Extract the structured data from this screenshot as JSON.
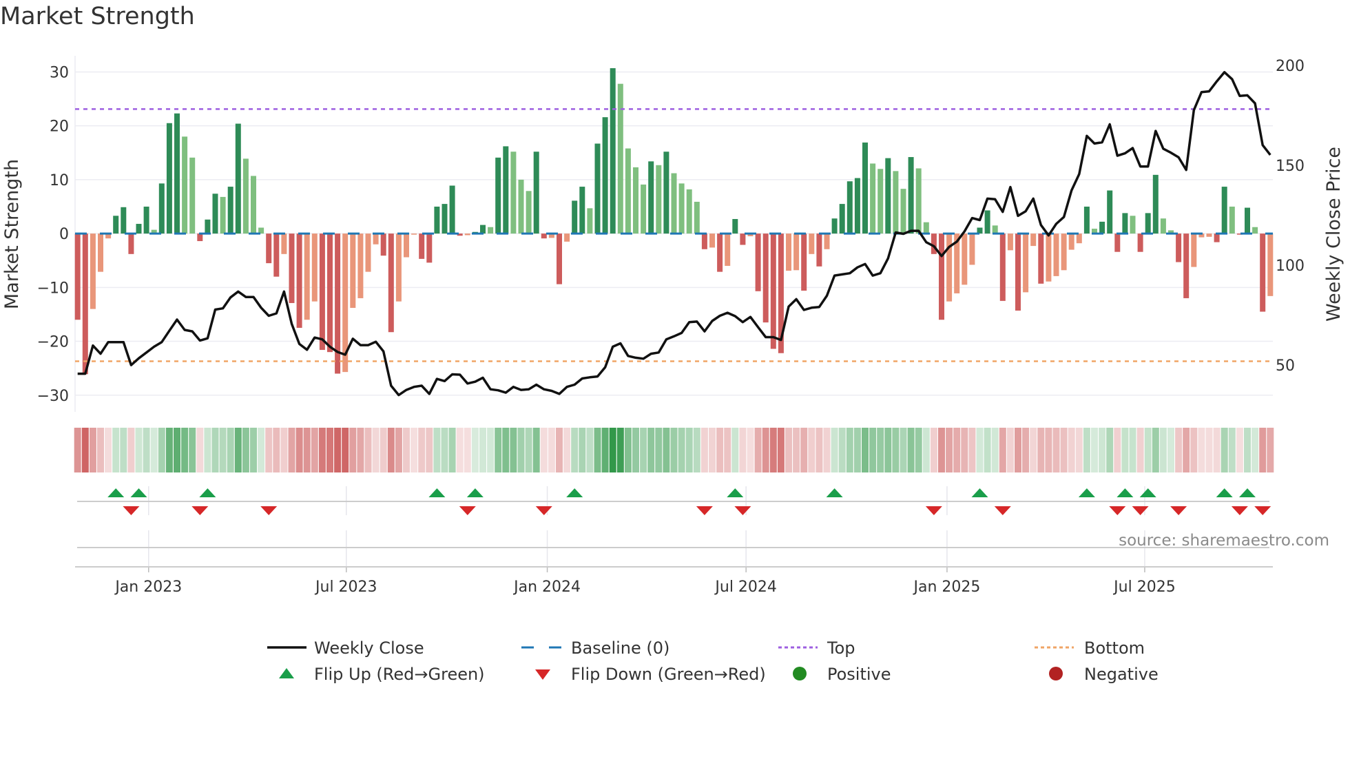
{
  "chart_data": {
    "type": "bar",
    "title": "Market Strength",
    "ylabel": "Market Strength",
    "y2label": "Weekly Close Price",
    "ylim": [
      -33.1,
      33
    ],
    "y2lim": [
      26.6,
      204.8
    ],
    "yticks": [
      30,
      20,
      10,
      0,
      -10,
      -20,
      -30
    ],
    "ytick_labels": [
      "30",
      "20",
      "10",
      "0",
      "−10",
      "−20",
      "−30"
    ],
    "y2ticks": [
      200,
      150,
      100,
      50
    ],
    "y2tick_labels": [
      "200",
      "150",
      "100",
      "50"
    ],
    "x_start_week": "2022-10-28",
    "x_frequency": "weekly",
    "xticks": [
      {
        "date": "2023-01-01",
        "label": "Jan 2023"
      },
      {
        "date": "2023-07-01",
        "label": "Jul 2023"
      },
      {
        "date": "2024-01-01",
        "label": "Jan 2024"
      },
      {
        "date": "2024-07-01",
        "label": "Jul 2024"
      },
      {
        "date": "2025-01-01",
        "label": "Jan 2025"
      },
      {
        "date": "2025-07-01",
        "label": "Jul 2025"
      }
    ],
    "top_threshold": 23.1,
    "bottom_threshold": -23.7,
    "baseline": 0,
    "strength": [
      -16,
      -26.1,
      -14,
      -7.1,
      -0.9,
      3.3,
      4.9,
      -3.8,
      1.8,
      5,
      0.7,
      9.3,
      20.5,
      22.3,
      18,
      14.1,
      -1.4,
      2.6,
      7.4,
      6.8,
      8.7,
      20.4,
      13.9,
      10.7,
      1.1,
      -5.5,
      -8,
      -3.8,
      -12.9,
      -17.5,
      -16,
      -12.6,
      -21.6,
      -22,
      -26,
      -25.7,
      -13.8,
      -12,
      -7.1,
      -2,
      -4.1,
      -18.3,
      -12.6,
      -4.4,
      -0.2,
      -4.7,
      -5.4,
      5,
      5.5,
      8.9,
      -0.4,
      -0.3,
      0.3,
      1.6,
      1.2,
      14.1,
      16.2,
      15.2,
      10,
      7.9,
      15.2,
      -0.9,
      -0.8,
      -9.4,
      -1.5,
      6.1,
      8.7,
      4.7,
      16.7,
      21.6,
      30.7,
      27.8,
      15.8,
      12.3,
      9.1,
      13.4,
      12.7,
      15.2,
      11.2,
      9.3,
      8.2,
      5.9,
      -2.9,
      -2.6,
      -7.1,
      -6,
      2.7,
      -2.1,
      -0.5,
      -10.7,
      -16.5,
      -21.4,
      -22.2,
      -6.9,
      -6.8,
      -10.6,
      -3.8,
      -6.1,
      -2.9,
      2.8,
      5.5,
      9.7,
      10.3,
      16.9,
      13,
      12,
      14,
      11.6,
      8.3,
      14.2,
      12.1,
      2.1,
      -3.8,
      -16,
      -12.6,
      -11.1,
      -9.5,
      -5.8,
      1.1,
      4.3,
      1.5,
      -12.5,
      -3.1,
      -14.3,
      -10.9,
      -2.3,
      -9.3,
      -8.9,
      -7.9,
      -6.8,
      -3,
      -1.8,
      5,
      0.9,
      2.2,
      8,
      -3.4,
      3.8,
      3.3,
      -3.4,
      3.8,
      10.9,
      2.8,
      0.6,
      -5.3,
      -12,
      -6.2,
      -0.7,
      -0.6,
      -1.6,
      8.7,
      5,
      -0.2,
      4.8,
      1.2,
      -14.5,
      -11.6
    ],
    "weekly_close": [
      45.7,
      45.7,
      59.8,
      55.7,
      61.5,
      61.5,
      61.5,
      50,
      53.4,
      56.3,
      59.2,
      61.5,
      67.2,
      72.8,
      67.6,
      66.9,
      62.3,
      63.4,
      77.8,
      78.4,
      83.9,
      86.8,
      84.1,
      84.1,
      78.7,
      74.7,
      75.9,
      86.8,
      70.7,
      60.6,
      57.7,
      63.8,
      62.9,
      59.2,
      56.6,
      55.2,
      63.2,
      60,
      60,
      61.7,
      56.9,
      39.7,
      35,
      37.6,
      39.1,
      39.7,
      35.6,
      43.1,
      42,
      45.4,
      45.2,
      40.8,
      41.7,
      43.7,
      37.9,
      37.4,
      36.2,
      39.1,
      37.6,
      37.9,
      40.2,
      37.9,
      37.1,
      35.6,
      39.1,
      40.2,
      43.3,
      43.9,
      44.3,
      48.9,
      59.2,
      60.9,
      54.6,
      53.7,
      53.2,
      55.7,
      56.3,
      62.9,
      64.4,
      66.1,
      71.5,
      71.8,
      66.9,
      72.1,
      74.7,
      76.2,
      74.5,
      71.5,
      74.1,
      69,
      64,
      64,
      62.6,
      79.3,
      83,
      77.6,
      78.7,
      79.1,
      84.7,
      94.8,
      95.4,
      96,
      98.9,
      100.6,
      94.8,
      96,
      103.4,
      116.4,
      115.7,
      117.2,
      117.2,
      111.5,
      109.5,
      104.6,
      109.2,
      111.8,
      116.9,
      123.6,
      122.6,
      133.3,
      133,
      126.7,
      139.1,
      124.7,
      127,
      133.3,
      120.1,
      114.9,
      120.7,
      124.1,
      137.4,
      145.6,
      164.7,
      160.9,
      161.5,
      170.5,
      154.8,
      156,
      158.6,
      149.4,
      149.4,
      167.2,
      158.3,
      156.3,
      154,
      147.7,
      177.6,
      186.6,
      187,
      192,
      196.6,
      193.1,
      184.7,
      185,
      181,
      160.1,
      155.2
    ],
    "flip_up_weeks": [
      5,
      8,
      17,
      47,
      52,
      65,
      86,
      99,
      118,
      132,
      137,
      140,
      150,
      153
    ],
    "flip_down_weeks": [
      7,
      16,
      25,
      51,
      61,
      82,
      87,
      112,
      121,
      136,
      139,
      144,
      152,
      155
    ],
    "legend": {
      "placement": "bottom",
      "weekly_close": "Weekly Close",
      "baseline": "Baseline (0)",
      "top": "Top",
      "bottom": "Bottom",
      "flip_up": "Flip Up (Red→Green)",
      "flip_down": "Flip Down (Green→Red)",
      "positive": "Positive",
      "negative": "Negative"
    },
    "source": "source: sharemaestro.com",
    "colors": {
      "pos_dark": "#2e8b57",
      "pos_light": "#7fbf7f",
      "neg_dark": "#cd5c5c",
      "neg_light": "#e9967a",
      "baseline": "#1f77b4",
      "top": "#9d5fe0",
      "bottom": "#f0a566",
      "flip_up": "#1a9e4a",
      "flip_down": "#d62728",
      "positive": "#228b22",
      "negative": "#b22222",
      "price": "#111111"
    }
  }
}
